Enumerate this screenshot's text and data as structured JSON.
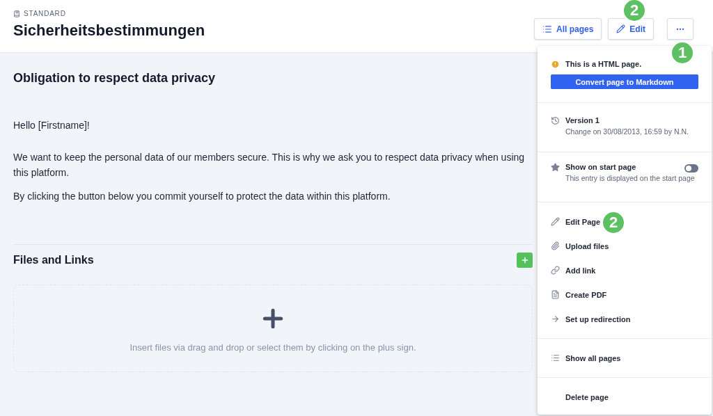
{
  "header": {
    "category": "STANDARD",
    "title": "Sicherheitsbestimmungen",
    "buttons": [
      {
        "kind": "list",
        "label": "All pages"
      },
      {
        "kind": "edit",
        "label": "Edit"
      },
      {
        "kind": "more"
      }
    ]
  },
  "article": {
    "heading": "Obligation to respect data privacy",
    "paragraphs": [
      "Hello [Firstname]!",
      "We want to keep the personal data of our members secure. This is why we ask you to respect data privacy when using this platform.",
      "By clicking the button below you commit yourself to protect the data within this platform."
    ]
  },
  "files": {
    "title": "Files and Links",
    "dropzone_hint": "Insert files via drag and drop or select them by clicking on the plus sign."
  },
  "menu": {
    "sections": [
      {
        "kind": "notice",
        "text": "This is a HTML page.",
        "button": "Convert page to Markdown"
      },
      {
        "kind": "version",
        "title": "Version 1",
        "subtitle": "Change on 30/08/2013, 16:59 by N.N."
      },
      {
        "kind": "toggle",
        "title": "Show on start page",
        "subtitle": "This entry is displayed on the start page",
        "on": false
      },
      {
        "kind": "actions",
        "items": [
          {
            "kind": "edit",
            "label": "Edit Page"
          },
          {
            "kind": "upload",
            "label": "Upload files"
          },
          {
            "kind": "link",
            "label": "Add link"
          },
          {
            "kind": "pdf",
            "label": "Create PDF"
          },
          {
            "kind": "redirect",
            "label": "Set up redirection"
          }
        ]
      },
      {
        "kind": "actions",
        "items": [
          {
            "kind": "list",
            "label": "Show all pages"
          }
        ]
      },
      {
        "kind": "actions",
        "items": [
          {
            "kind": "delete",
            "label": "Delete page"
          }
        ]
      }
    ]
  },
  "callouts": [
    {
      "number": "2"
    },
    {
      "number": "1"
    },
    {
      "number": "2"
    }
  ]
}
